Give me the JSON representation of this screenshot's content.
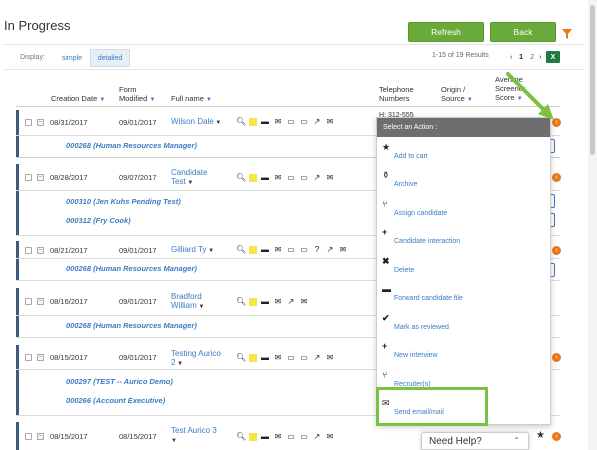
{
  "page": {
    "title": "In Progress"
  },
  "toolbar": {
    "refresh_label": "Refresh",
    "back_label": "Back"
  },
  "display": {
    "label": "Display:",
    "tabs": [
      {
        "label": "simple",
        "active": false
      },
      {
        "label": "detailed",
        "active": true
      }
    ]
  },
  "pagination": {
    "results": "1-15 of 19 Results",
    "prev": "‹",
    "pages": [
      "1",
      "2"
    ],
    "next": "›",
    "current": "1"
  },
  "columns": {
    "creation_date": "Creation Date",
    "form_modified_1": "Form",
    "form_modified_2": "Modified",
    "full_name": "Full name",
    "telephone_1": "Telephone",
    "telephone_2": "Numbers",
    "origin_1": "Origin /",
    "origin_2": "Source",
    "score_1": "Average",
    "score_2": "Screener",
    "score_3": "Score"
  },
  "rows": [
    {
      "created": "08/31/2017",
      "modified": "09/01/2017",
      "name1": "Wilson Dale",
      "name2": "",
      "telephone": "H: 312-555",
      "subs": [
        "000268 (Human Resources Manager)"
      ]
    },
    {
      "created": "08/28/2017",
      "modified": "09/07/2017",
      "name1": "Candidate",
      "name2": "Test",
      "subs": [
        "000310 (Jen Kuhs Pending Test)",
        "000312 (Fry Cook)"
      ]
    },
    {
      "created": "08/21/2017",
      "modified": "09/01/2017",
      "name1": "Gilliard Ty",
      "name2": "",
      "subs": [
        "000268 (Human Resources Manager)"
      ]
    },
    {
      "created": "08/16/2017",
      "modified": "09/01/2017",
      "name1": "Bradford",
      "name2": "William",
      "subs": [
        "000268 (Human Resources Manager)"
      ]
    },
    {
      "created": "08/15/2017",
      "modified": "09/01/2017",
      "name1": "Testing Aurico",
      "name2": "2",
      "subs": [
        "000297 (TEST -- Aurico Demo)",
        "000266 (Account Executive)"
      ]
    },
    {
      "created": "08/15/2017",
      "modified": "08/15/2017",
      "name1": "Test Aurico 3",
      "name2": "",
      "subs": []
    }
  ],
  "action_menu": {
    "header": "Select an Action :",
    "items": [
      {
        "label": "Add to cart",
        "icon": "star-icon"
      },
      {
        "label": "Archive",
        "icon": "archive-icon"
      },
      {
        "label": "Assign candidate",
        "icon": "assign-icon"
      },
      {
        "label": "Candidate interaction",
        "icon": "plus-icon"
      },
      {
        "label": "Delete",
        "icon": "delete-icon"
      },
      {
        "label": "Forward candidate file",
        "icon": "forward-icon"
      },
      {
        "label": "Mark as reviewed",
        "icon": "check-icon"
      },
      {
        "label": "New interview",
        "icon": "plus-icon"
      },
      {
        "label": "Recruiter(s)",
        "icon": "recruiter-icon"
      },
      {
        "label": "Send email/mail",
        "icon": "envelope-icon"
      }
    ]
  },
  "help": {
    "label": "Need Help?"
  },
  "colors": {
    "accent_green": "#6aaa3a",
    "link_blue": "#3a7cc3",
    "orange": "#e9791b",
    "highlight": "#7bc142"
  }
}
